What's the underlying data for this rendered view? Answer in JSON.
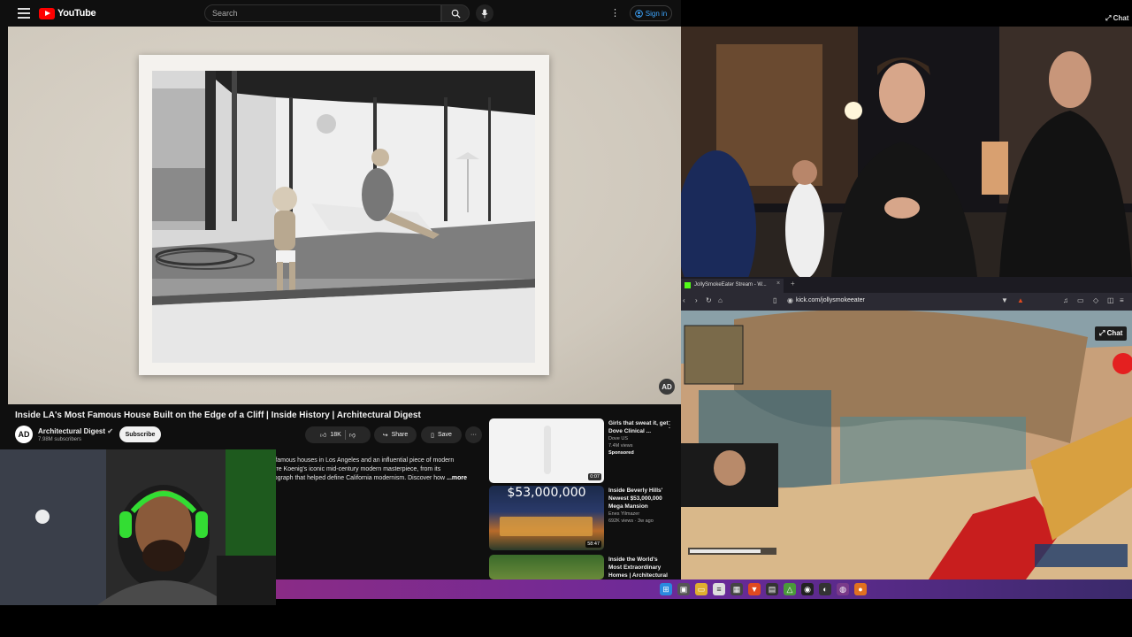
{
  "youtube": {
    "logo_text": "YouTube",
    "search_placeholder": "Search",
    "sign_in": "Sign in",
    "brand_color": "#ff0000",
    "video": {
      "title": "Inside LA's Most Famous House Built on the Edge of a Cliff | Inside History | Architectural Digest",
      "channel_name": "Architectural Digest",
      "channel_avatar": "AD",
      "subscribers": "7.98M subscribers",
      "subscribe_label": "Subscribe",
      "likes": "18K",
      "share_label": "Share",
      "save_label": "Save",
      "watermark": "AD",
      "description_lines": [
        "ost famous houses in Los Angeles and an influential piece of modern",
        "Pierre Koenig's iconic mid-century modern masterpiece, from its",
        "hotograph that helped define California modernism. Discover how"
      ],
      "description_more": "...more"
    },
    "related": [
      {
        "title": "Girls that sweat it, get Dove Clinical ...",
        "channel": "Dove US",
        "meta": "7.4M views",
        "badge": "Sponsored",
        "duration": "0:07"
      },
      {
        "title": "Inside Beverly Hills' Newest $53,000,000 Mega Mansion",
        "channel": "Enes Yilmazer",
        "meta": "692K views · 3w ago",
        "thumb_text": "$53,000,000",
        "duration": "58:47"
      },
      {
        "title": "Inside the World's Most Extraordinary Homes | Architectural Digest",
        "channel": "",
        "meta": "",
        "duration": ""
      }
    ]
  },
  "stream": {
    "chat_label_top": "Chat",
    "tab_title": "JollySmokeEater Stream - W...",
    "url": "kick.com/jollysmokeeater",
    "chat_label": "Chat"
  }
}
